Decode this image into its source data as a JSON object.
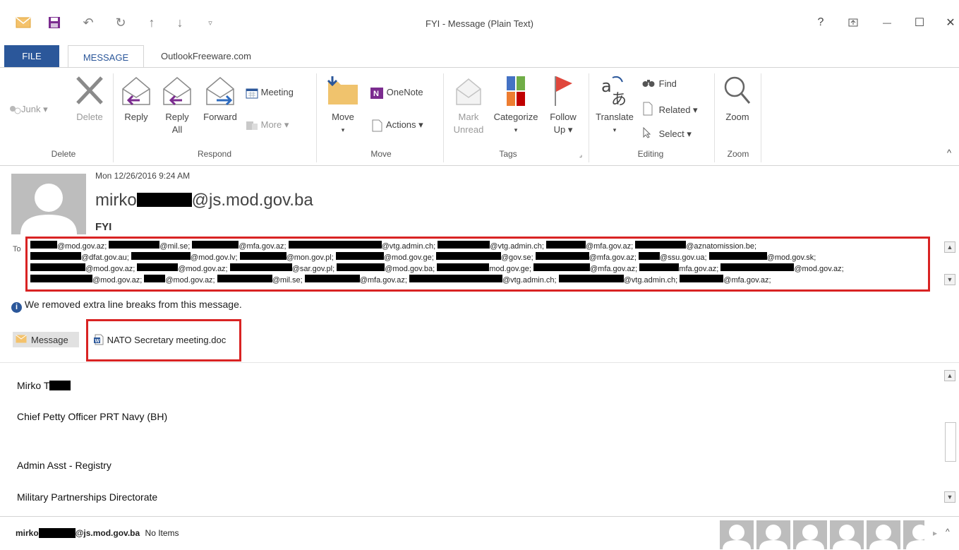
{
  "window": {
    "title": "FYI - Message (Plain Text)",
    "controls": {
      "help": "?",
      "restore": "⇱",
      "minimize": "—",
      "maximize": "☐",
      "close": "✕"
    }
  },
  "tabs": [
    {
      "label": "FILE"
    },
    {
      "label": "MESSAGE"
    },
    {
      "label": "OutlookFreeware.com"
    }
  ],
  "ribbon": {
    "delete_group": {
      "junk": "Junk ▾",
      "delete": "Delete",
      "label": "Delete"
    },
    "respond_group": {
      "reply": "Reply",
      "reply_all_1": "Reply",
      "reply_all_2": "All",
      "forward": "Forward",
      "meeting": "Meeting",
      "more": "More ▾",
      "label": "Respond"
    },
    "move_group": {
      "move": "Move",
      "move_arrow": "▾",
      "onenote": "OneNote",
      "actions": "Actions ▾",
      "label": "Move"
    },
    "tags_group": {
      "mark_unread_1": "Mark",
      "mark_unread_2": "Unread",
      "categorize": "Categorize",
      "categorize_arrow": "▾",
      "follow_up_1": "Follow",
      "follow_up_2": "Up ▾",
      "label": "Tags"
    },
    "editing_group": {
      "translate": "Translate",
      "translate_arrow": "▾",
      "find": "Find",
      "related": "Related ▾",
      "select": "Select ▾",
      "label": "Editing"
    },
    "zoom_group": {
      "zoom": "Zoom",
      "label": "Zoom"
    },
    "collapse": "^"
  },
  "message": {
    "date": "Mon 12/26/2016 9:24 AM",
    "sender_prefix": "mirko",
    "sender_suffix": "@js.mod.gov.ba",
    "subject": "FYI",
    "to_label": "To",
    "recipients_line1": [
      "@mod.gov.az;",
      "@mil.se;",
      "@mfa.gov.az;",
      "@vtg.admin.ch;",
      "@vtg.admin.ch;",
      "@mfa.gov.az;",
      "@aznatomission.be;"
    ],
    "recipients_line2": [
      "@dfat.gov.au;",
      "@mod.gov.lv;",
      "@mon.gov.pl;",
      "@mod.gov.ge;",
      "@gov.se;",
      "@mfa.gov.az;",
      "@ssu.gov.ua;",
      "@mod.gov.sk;"
    ],
    "recipients_line3": [
      "@mod.gov.az;",
      "@mod.gov.az;",
      "@sar.gov.pl;",
      "@mod.gov.ba;",
      "mod.gov.ge;",
      "@mfa.gov.az;",
      "mfa.gov.az;",
      "@mod.gov.az;"
    ],
    "recipients_line4": [
      "@mod.gov.az;",
      "@mod.gov.az;",
      "@mil.se;",
      "@mfa.gov.az;",
      "@vtg.admin.ch;",
      "@vtg.admin.ch;",
      "@mfa.gov.az;"
    ],
    "info_notice": "We removed extra line breaks from this message.",
    "message_tab": "Message",
    "attachment_name": "NATO Secretary meeting.doc",
    "body_lines": {
      "name_prefix": "Mirko T",
      "rank": "Chief Petty Officer PRT Navy (BH)",
      "role": "Admin Asst - Registry",
      "dept": "Military Partnerships Directorate"
    }
  },
  "statusbar": {
    "sender_prefix": "mirko",
    "sender_suffix": "@js.mod.gov.ba",
    "items": "No Items"
  },
  "colors": {
    "accent": "#2b579a",
    "highlight_border": "#d92323",
    "redaction": "#000000",
    "avatar_gray": "#bdbdbd"
  }
}
